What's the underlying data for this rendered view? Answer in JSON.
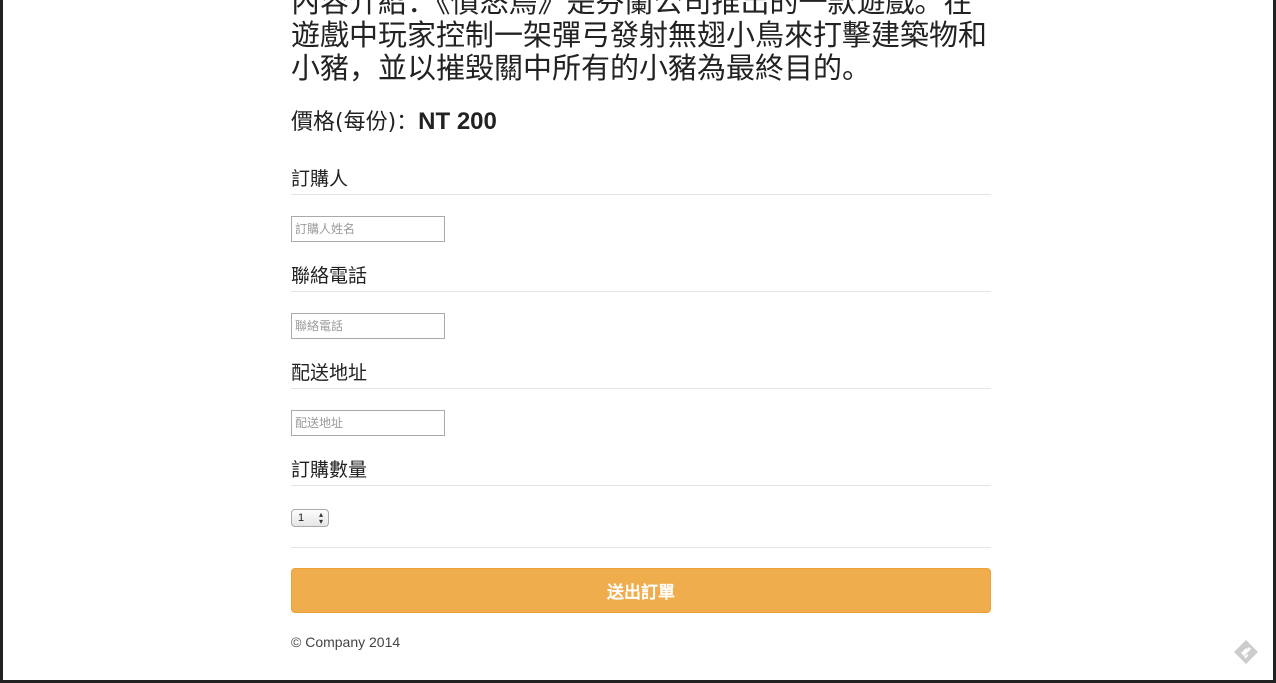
{
  "product": {
    "intro": "內容介紹：《憤怒鳥》是芬蘭公司推出的一款遊戲。在遊戲中玩家控制一架彈弓發射無翅小鳥來打擊建築物和小豬，並以摧毀關中所有的小豬為最終目的。",
    "price_label": "價格(每份)：",
    "price_value": "NT 200"
  },
  "form": {
    "name_label": "訂購人",
    "name_placeholder": "訂購人姓名",
    "phone_label": "聯絡電話",
    "phone_placeholder": "聯絡電話",
    "address_label": "配送地址",
    "address_placeholder": "配送地址",
    "quantity_label": "訂購數量",
    "quantity_value": "1",
    "submit_label": "送出訂單"
  },
  "footer": {
    "copyright": "© Company 2014"
  },
  "icons": {
    "corner": "feedly-icon"
  },
  "colors": {
    "submit_bg": "#f0ad4e",
    "corner_icon": "#cccccc"
  }
}
